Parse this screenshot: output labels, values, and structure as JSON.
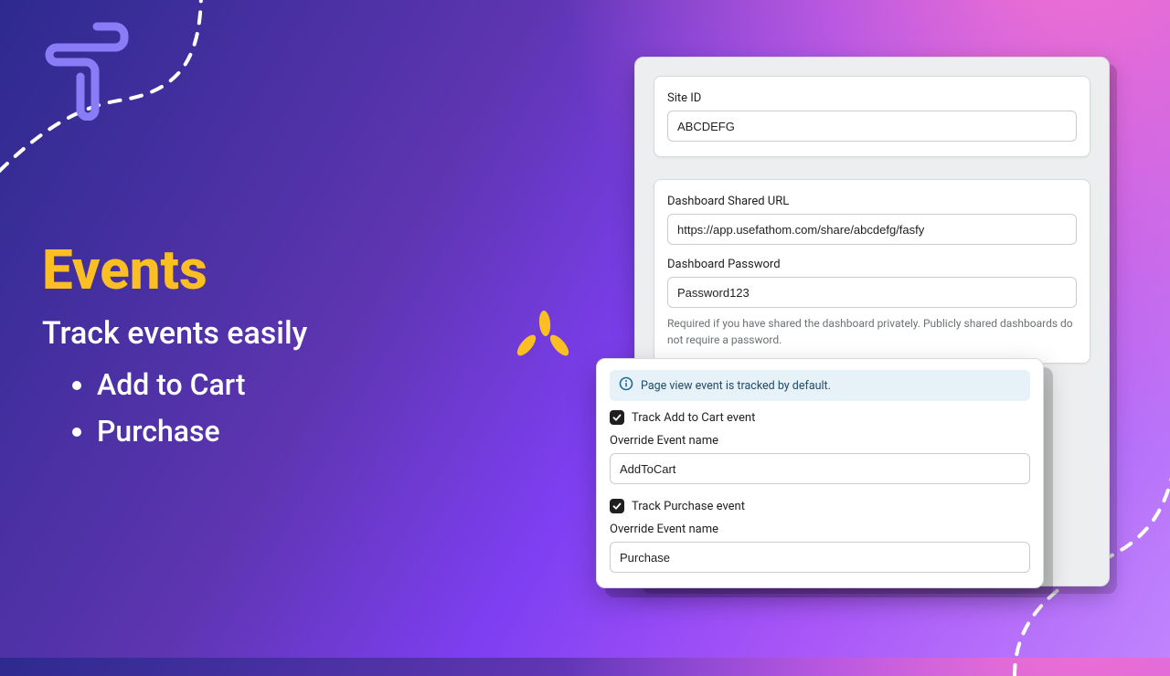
{
  "colors": {
    "accent": "#fbbf24",
    "checkbox_bg": "#1f1f1f",
    "info_bg": "#e7f2f8"
  },
  "hero": {
    "title": "Events",
    "subtitle": "Track events easily",
    "bullets": [
      "Add to Cart",
      "Purchase"
    ]
  },
  "settings": {
    "site_id": {
      "label": "Site ID",
      "value": "ABCDEFG"
    },
    "dashboard_url": {
      "label": "Dashboard Shared URL",
      "value": "https://app.usefathom.com/share/abcdefg/fasfy"
    },
    "dashboard_password": {
      "label": "Dashboard Password",
      "value": "Password123",
      "helper": "Required if you have shared the dashboard privately. Publicly shared dashboards do not require a password."
    }
  },
  "events": {
    "info_banner": "Page view event is tracked by default.",
    "add_to_cart": {
      "checked": true,
      "checkbox_label": "Track Add to Cart event",
      "override_label": "Override Event name",
      "override_value": "AddToCart"
    },
    "purchase": {
      "checked": true,
      "checkbox_label": "Track Purchase event",
      "override_label": "Override Event name",
      "override_value": "Purchase"
    }
  }
}
